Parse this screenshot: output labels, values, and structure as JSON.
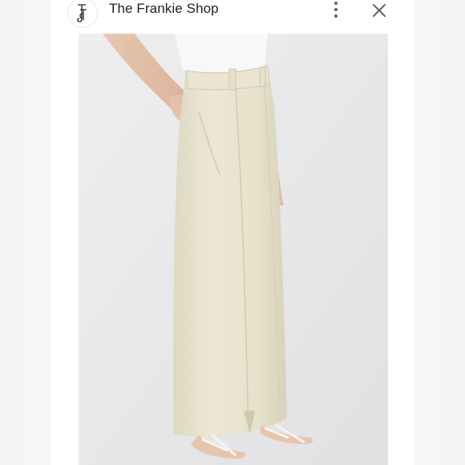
{
  "header": {
    "site_name": "The Frankie Shop",
    "logo_text": "TFS"
  },
  "icons": {
    "logo": "brand-logo-icon",
    "more": "more-vertical-icon",
    "close": "close-icon"
  },
  "image": {
    "alt": "Model wearing a long beige tailored maxi skirt with white strappy sandals",
    "background_color": "#e6e6e8",
    "garment_color": "#e7e3cf"
  }
}
